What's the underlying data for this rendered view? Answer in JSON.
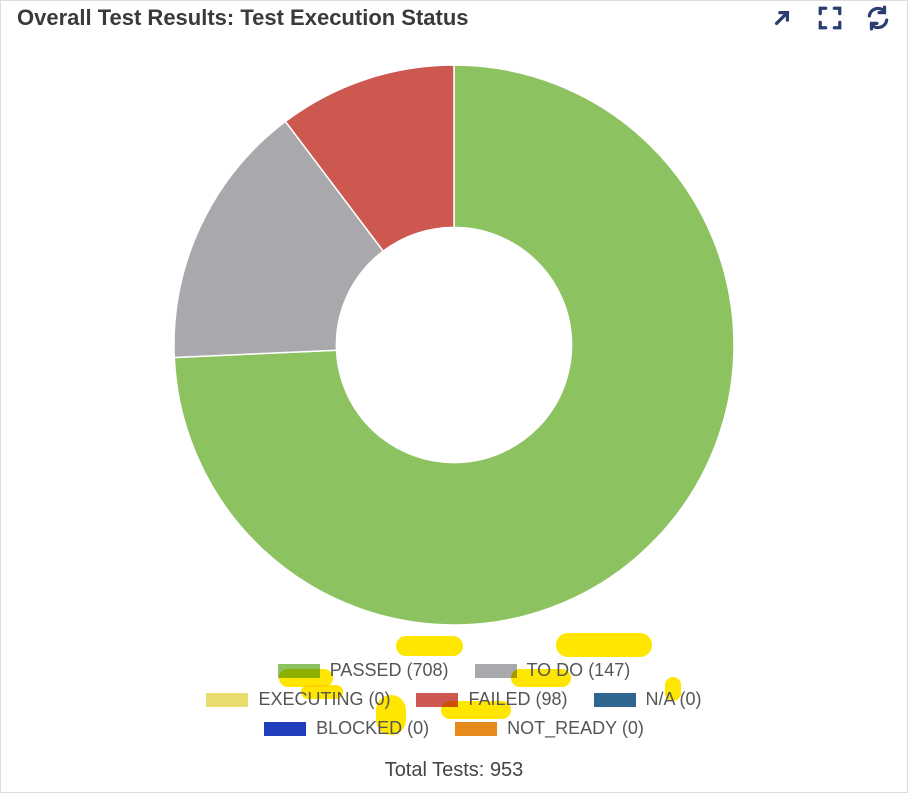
{
  "header": {
    "title": "Overall Test Results: Test Execution Status"
  },
  "chart_data": {
    "type": "pie",
    "title": "Overall Test Results: Test Execution Status",
    "hole": 0.42,
    "series": [
      {
        "name": "PASSED",
        "value": 708,
        "color": "#8dc261"
      },
      {
        "name": "TO DO",
        "value": 147,
        "color": "#a9a9ad"
      },
      {
        "name": "EXECUTING",
        "value": 0,
        "color": "#e9dd6e"
      },
      {
        "name": "FAILED",
        "value": 98,
        "color": "#cc5850"
      },
      {
        "name": "N/A",
        "value": 0,
        "color": "#2f6690"
      },
      {
        "name": "BLOCKED",
        "value": 0,
        "color": "#1f3fbf"
      },
      {
        "name": "NOT_READY",
        "value": 0,
        "color": "#e68a1d"
      }
    ],
    "totalLabel": "Total Tests:",
    "total": 953
  },
  "legend_rows": [
    [
      0,
      1
    ],
    [
      2,
      3,
      4
    ],
    [
      5,
      6
    ]
  ]
}
